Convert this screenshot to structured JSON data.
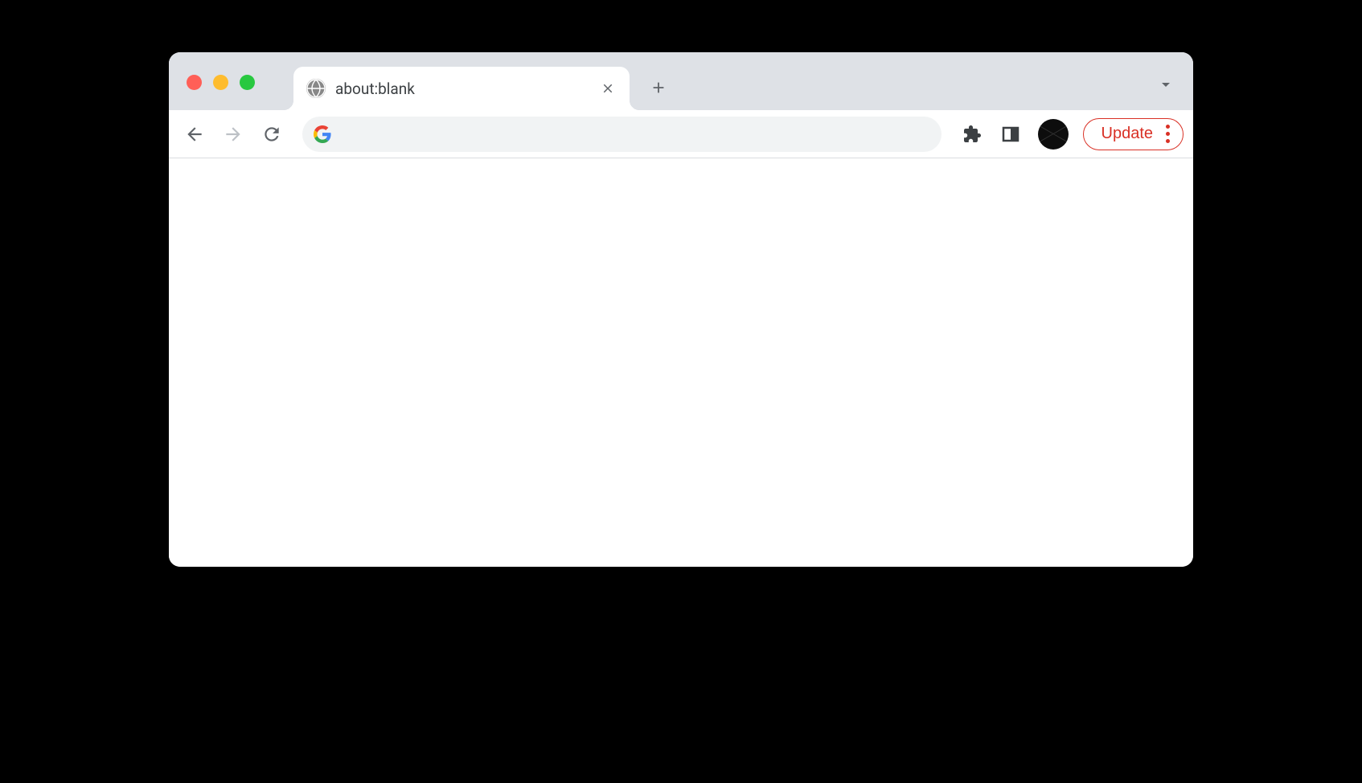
{
  "tab": {
    "title": "about:blank",
    "favicon": "globe-icon"
  },
  "toolbar": {
    "address_value": "",
    "update_label": "Update"
  },
  "colors": {
    "accent_red": "#d93025",
    "tab_strip_bg": "#dee1e6",
    "address_bg": "#f1f3f4"
  }
}
